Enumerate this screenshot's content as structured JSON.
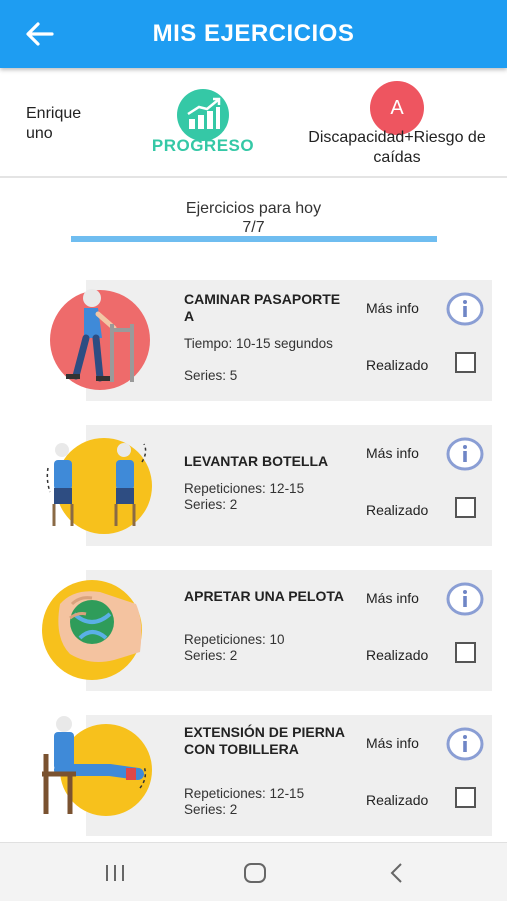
{
  "app": {
    "title": "MIS EJERCICIOS",
    "primary_color": "#1e9df2"
  },
  "header": {
    "user_name": "Enrique uno",
    "progress_label": "PROGRESO",
    "progress_icon": "bar-chart-growth-icon",
    "category_letter": "A",
    "category_label": "Discapacidad+Riesgo de caídas"
  },
  "today": {
    "label": "Ejercicios para hoy",
    "count": "7/7",
    "completed_fraction": 1.0
  },
  "exercises": [
    {
      "name": "CAMINAR PASAPORTE A",
      "details": [
        "Tiempo: 10-15 segundos",
        "Series: 5"
      ],
      "more_info": "Más info",
      "done_label": "Realizado",
      "done": false,
      "image": "walker-elderly-icon",
      "image_bg": "#ee6b6b"
    },
    {
      "name": "LEVANTAR BOTELLA",
      "details": [
        "Repeticiones: 12-15",
        "Series: 2"
      ],
      "more_info": "Más info",
      "done_label": "Realizado",
      "done": false,
      "image": "arm-raise-seated-icon",
      "image_bg": "#f7c11c"
    },
    {
      "name": "APRETAR UNA PELOTA",
      "details": [
        "Repeticiones: 10",
        "Series: 2"
      ],
      "more_info": "Más info",
      "done_label": "Realizado",
      "done": false,
      "image": "hand-squeeze-ball-icon",
      "image_bg": "#f7c11c"
    },
    {
      "name": "EXTENSIÓN DE PIERNA CON TOBILLERA",
      "details": [
        "Repeticiones: 12-15",
        "Series: 2"
      ],
      "more_info": "Más info",
      "done_label": "Realizado",
      "done": false,
      "image": "leg-extension-seated-icon",
      "image_bg": "#f7c11c"
    }
  ],
  "nav": {
    "recent": "recent-apps-icon",
    "home": "home-icon",
    "back": "back-chevron-icon"
  }
}
